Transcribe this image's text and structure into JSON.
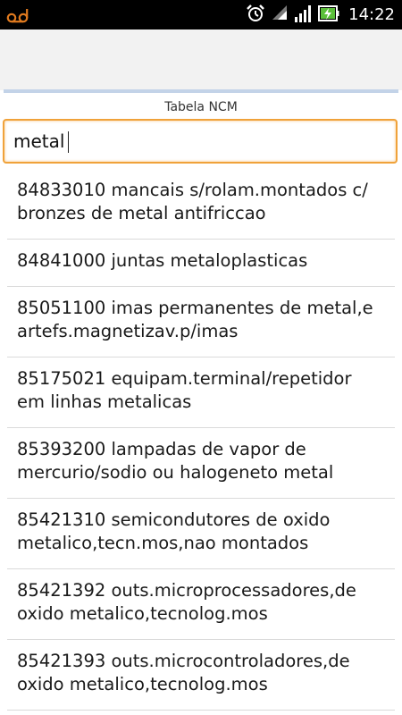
{
  "status_bar": {
    "time": "14:22",
    "icons": [
      "voicemail-icon",
      "alarm-icon",
      "wifi-icon",
      "signal-icon",
      "battery-charging-icon"
    ]
  },
  "section": {
    "title": "Tabela NCM"
  },
  "search": {
    "value": "metal"
  },
  "results": [
    {
      "text": "84833010 mancais s/rolam.montados c/ bronzes de metal antifriccao"
    },
    {
      "text": "84841000 juntas metaloplasticas"
    },
    {
      "text": "85051100 imas permanentes de metal,e artefs.magnetizav.p/imas"
    },
    {
      "text": "85175021 equipam.terminal/repetidor em linhas metalicas"
    },
    {
      "text": "85393200 lampadas de vapor de mercurio/sodio ou halogeneto metal"
    },
    {
      "text": "85421310 semicondutores de oxido metalico,tecn.mos,nao montados"
    },
    {
      "text": "85421392 outs.microprocessadores,de oxido metalico,tecnolog.mos"
    },
    {
      "text": "85421393 outs.microcontroladores,de oxido metalico,tecnolog.mos"
    }
  ],
  "colors": {
    "accent": "#f0a23a",
    "status_bar": "#000000",
    "battery": "#5bbf3a"
  }
}
